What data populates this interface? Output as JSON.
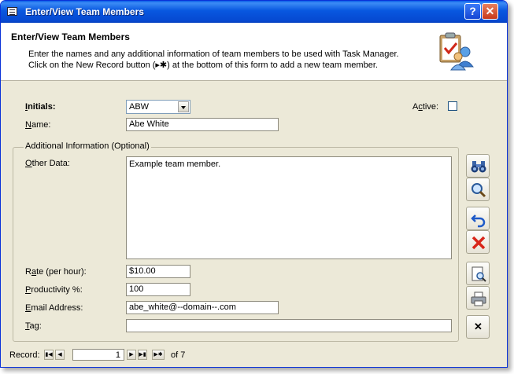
{
  "window": {
    "title": "Enter/View Team Members"
  },
  "header": {
    "title": "Enter/View Team Members",
    "line1": "Enter the names and any additional information of team members to be used with Task Manager.",
    "line2": "Click on the New Record button (▸✱) at the bottom of this form to add a new team member."
  },
  "form": {
    "initials_label_pre": "",
    "initials_label_u": "I",
    "initials_label_post": "nitials:",
    "initials_value": "ABW",
    "active_label_pre": "A",
    "active_label_u": "c",
    "active_label_post": "tive:",
    "active_checked": false,
    "name_label_u": "N",
    "name_label_post": "ame:",
    "name_value": "Abe White",
    "group_label": "Additional Information (Optional)",
    "other_label_u": "O",
    "other_label_post": "ther Data:",
    "other_value": "Example team member.",
    "rate_label_pre": "R",
    "rate_label_u": "a",
    "rate_label_post": "te (per hour):",
    "rate_value": "$10.00",
    "prod_label_u": "P",
    "prod_label_post": "roductivity %:",
    "prod_value": "100",
    "email_label_u": "E",
    "email_label_post": "mail Address:",
    "email_value": "abe_white@--domain--.com",
    "tag_label_u": "T",
    "tag_label_post": "ag:",
    "tag_value": ""
  },
  "sidebar": {
    "icons": [
      "binoculars-icon",
      "magnifier-icon",
      "undo-icon",
      "delete-icon",
      "print-preview-icon",
      "print-icon",
      "close-icon"
    ],
    "close_glyph": "✕"
  },
  "navigation": {
    "label": "Record:",
    "current": "1",
    "of_text": "of  7",
    "first": "▮◀",
    "prev": "◀",
    "next": "▶",
    "last": "▶▮",
    "new": "▶✱"
  }
}
